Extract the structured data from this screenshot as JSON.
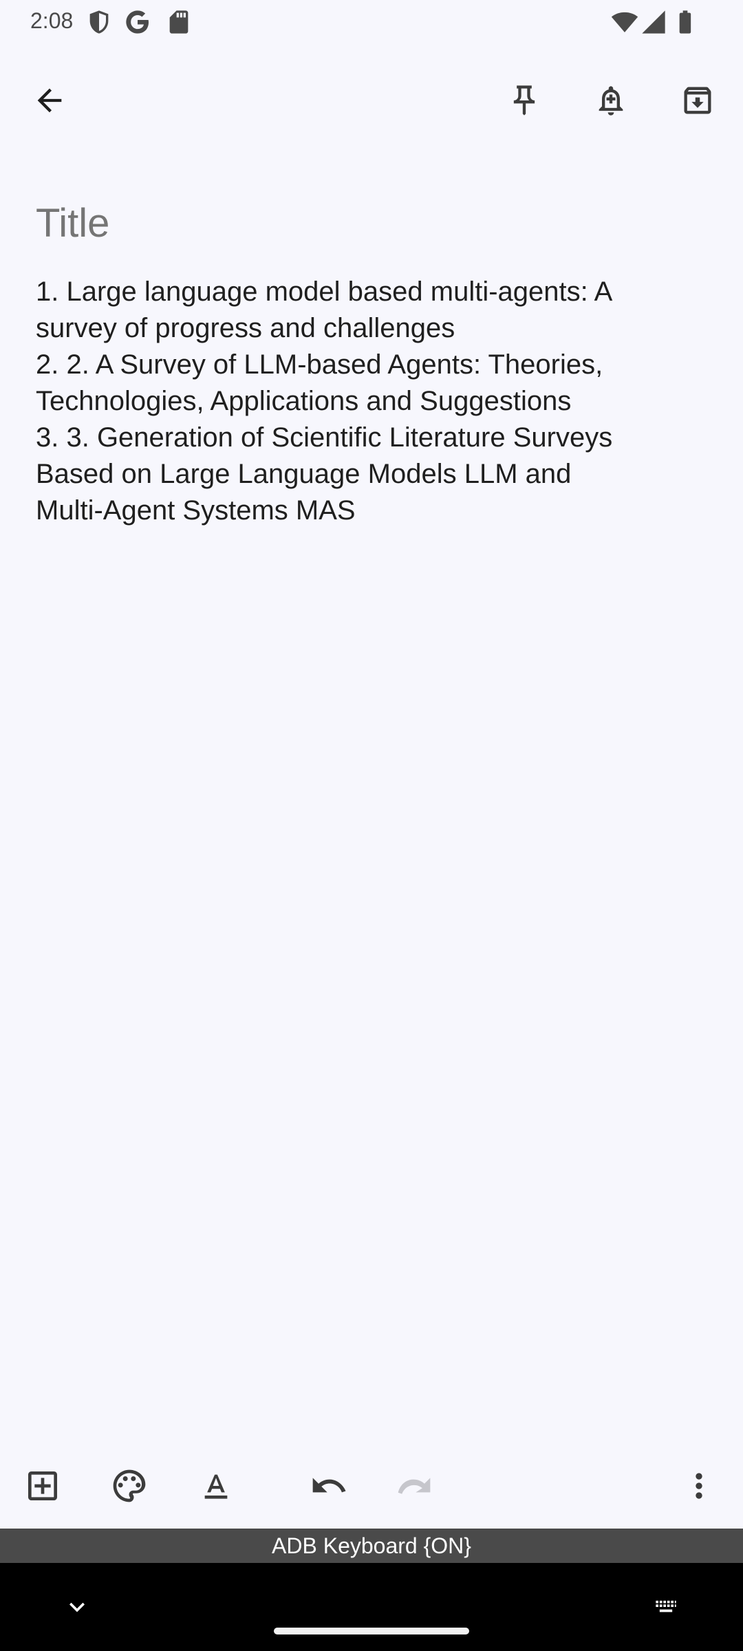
{
  "status_bar": {
    "time": "2:08",
    "icons": [
      "shield-icon",
      "google-g-icon",
      "sd-card-icon",
      "wifi-icon",
      "cell-signal-icon",
      "battery-icon"
    ]
  },
  "app_bar": {
    "icons": [
      "back-arrow-icon",
      "pin-icon",
      "reminder-bell-icon",
      "archive-icon"
    ]
  },
  "note": {
    "title_placeholder": "Title",
    "body": "1. Large language model based multi-agents: A\nsurvey of progress and challenges\n2. 2. A Survey of LLM-based Agents: Theories,\nTechnologies, Applications and Suggestions\n3. 3. Generation of Scientific Literature Surveys\nBased on Large Language Models LLM and\nMulti-Agent Systems MAS"
  },
  "editor_toolbar": {
    "icons": [
      "add-box-icon",
      "palette-icon",
      "text-format-icon",
      "undo-icon",
      "redo-icon",
      "more-vert-icon"
    ],
    "redo_enabled": false
  },
  "keyboard_banner": {
    "label": "ADB Keyboard {ON}"
  },
  "nav_bar": {
    "icons": [
      "chevron-down-icon",
      "keyboard-icon"
    ]
  },
  "colors": {
    "background": "#f7f7fd",
    "text_primary": "#1f1f1f",
    "text_hint": "#9a9a9f",
    "icon_disabled": "#c6c6cc",
    "banner": "#4a4a4a",
    "nav_bar": "#000000"
  }
}
